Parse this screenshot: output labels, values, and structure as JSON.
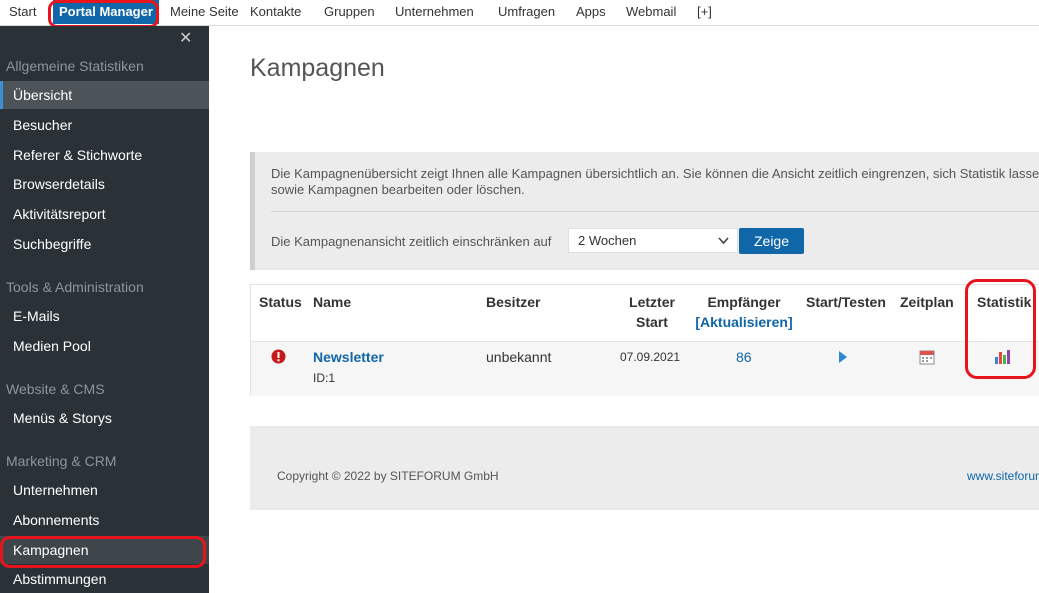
{
  "topnav": {
    "items": [
      {
        "label": "Start"
      },
      {
        "label": "Portal Manager",
        "active": true
      },
      {
        "label": "Meine Seite"
      },
      {
        "label": "Kontakte"
      },
      {
        "label": "Gruppen"
      },
      {
        "label": "Unternehmen"
      },
      {
        "label": "Umfragen"
      },
      {
        "label": "Apps"
      },
      {
        "label": "Webmail"
      },
      {
        "label": "[+]"
      }
    ]
  },
  "sidebar": {
    "close_icon": "close-icon",
    "sections": [
      {
        "title": "Allgemeine Statistiken",
        "items": [
          "Übersicht",
          "Besucher",
          "Referer & Stichworte",
          "Browserdetails",
          "Aktivitätsreport",
          "Suchbegriffe"
        ]
      },
      {
        "title": "Tools & Administration",
        "items": [
          "E-Mails",
          "Medien Pool"
        ]
      },
      {
        "title": "Website & CMS",
        "items": [
          "Menüs & Storys"
        ]
      },
      {
        "title": "Marketing & CRM",
        "items": [
          "Unternehmen",
          "Abonnements",
          "Kampagnen",
          "Abstimmungen"
        ]
      }
    ]
  },
  "main": {
    "title": "Kampagnen",
    "info_text": "Die Kampagnenübersicht zeigt Ihnen alle Kampagnen übersichtlich an. Sie können die Ansicht zeitlich eingrenzen, sich Statistik lassen sowie Kampagnen bearbeiten oder löschen.",
    "filter_label": "Die Kampagnenansicht zeitlich einschränken auf",
    "filter_value": "2 Wochen",
    "filter_button": "Zeige"
  },
  "table": {
    "headers": {
      "status": "Status",
      "name": "Name",
      "owner": "Besitzer",
      "last_start_1": "Letzter",
      "last_start_2": "Start",
      "recipients": "Empfänger",
      "refresh": "[Aktualisieren]",
      "start_test": "Start/Testen",
      "schedule": "Zeitplan",
      "stats": "Statistik"
    },
    "rows": [
      {
        "status_icon": "error-icon",
        "name": "Newsletter",
        "id": "ID:1",
        "owner": "unbekannt",
        "last_start": "07.09.2021",
        "recipients": "86",
        "start_icon": "play-icon",
        "schedule_icon": "calendar-icon",
        "stats_icon": "bar-chart-icon"
      }
    ]
  },
  "footer": {
    "copyright": "Copyright © 2022 by SITEFORUM GmbH",
    "website": "www.siteforum"
  },
  "colors": {
    "accent": "#0f66a8",
    "sidebar_bg": "#2b3237",
    "annotation": "#e8141c"
  }
}
